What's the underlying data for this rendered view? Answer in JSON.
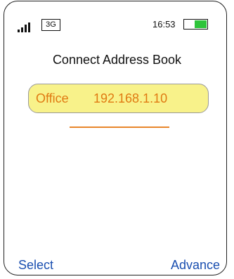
{
  "status_bar": {
    "signal_icon": "signal-strength-icon",
    "network": "3G",
    "time": "16:53",
    "battery_icon": "battery-icon"
  },
  "title": "Connect Address Book",
  "entries": [
    {
      "name": "Office",
      "address": "192.168.1.10",
      "selected": true
    }
  ],
  "softkeys": {
    "left": "Select",
    "right": "Advance"
  },
  "colors": {
    "highlight_fill": "#f8f28a",
    "entry_text": "#e07a12",
    "divider": "#e8862a",
    "softkey_text": "#1a4fb0",
    "battery_fill": "#2ec43a"
  }
}
